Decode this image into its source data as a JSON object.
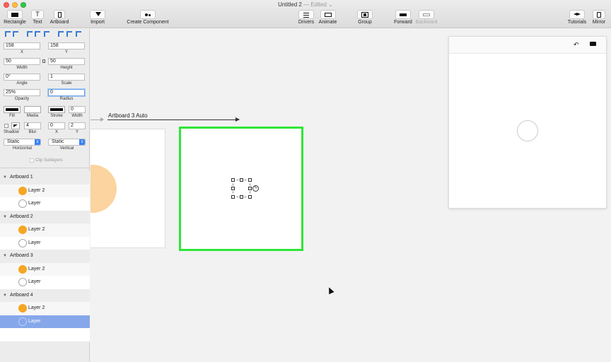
{
  "window": {
    "title": "Untitled 2",
    "status": "— Edited",
    "status_chevron": "⌄"
  },
  "toolbar": {
    "rectangle": "Rectangle",
    "text": "Text",
    "artboard": "Artboard",
    "import": "Import",
    "create_component": "Create Component",
    "drivers": "Drivers",
    "animate": "Animate",
    "group": "Group",
    "forward": "Forward",
    "backward": "Backward",
    "tutorials": "Tutorials",
    "mirror": "Mirror",
    "text_icon_glyph": "T"
  },
  "inspector": {
    "x": {
      "value": "158",
      "label": "X"
    },
    "y": {
      "value": "158",
      "label": "Y"
    },
    "width": {
      "value": "50",
      "label": "Width"
    },
    "height": {
      "value": "50",
      "label": "Height"
    },
    "angle": {
      "value": "0°",
      "label": "Angle"
    },
    "scale": {
      "value": "1",
      "label": "Scale"
    },
    "opacity": {
      "value": "25%",
      "label": "Opacity"
    },
    "radius": {
      "value": "0",
      "label": "Radius"
    },
    "fill_label": "Fill",
    "media_label": "Media",
    "stroke_label": "Stroke",
    "stroke_width": {
      "value": "0",
      "label": "Width"
    },
    "shadow_label": "Shadow",
    "blur": {
      "value": "4",
      "label": "Blur"
    },
    "shadow_x": {
      "value": "0",
      "label": "X"
    },
    "shadow_y": {
      "value": "2",
      "label": "Y"
    },
    "horizontal": {
      "value": "Static",
      "label": "Horizontal"
    },
    "vertical": {
      "value": "Static",
      "label": "Vertical"
    },
    "clip_sublayers": "Clip Sublayers"
  },
  "layers": [
    {
      "name": "Artboard 1",
      "type": "header"
    },
    {
      "name": "Layer 2",
      "type": "child",
      "icon": "orange"
    },
    {
      "name": "Layer",
      "type": "child",
      "icon": "hollow"
    },
    {
      "name": "Artboard 2",
      "type": "header"
    },
    {
      "name": "Layer 2",
      "type": "child",
      "icon": "orange"
    },
    {
      "name": "Layer",
      "type": "child",
      "icon": "hollow"
    },
    {
      "name": "Artboard 3",
      "type": "header"
    },
    {
      "name": "Layer 2",
      "type": "child",
      "icon": "orange"
    },
    {
      "name": "Layer",
      "type": "child",
      "icon": "hollow"
    },
    {
      "name": "Artboard 4",
      "type": "header"
    },
    {
      "name": "Layer 2",
      "type": "child",
      "icon": "orange"
    },
    {
      "name": "Layer",
      "type": "child",
      "icon": "hollow",
      "selected": true
    }
  ],
  "canvas": {
    "connection_label": "Artboard 3 Auto",
    "bolt_glyph": "ϟ"
  },
  "preview": {
    "undo_glyph": "↶",
    "record_glyph": "■"
  },
  "colors": {
    "selection_green": "#2ee636",
    "layer_orange": "#f5a623",
    "selected_row": "#86a7ea"
  }
}
